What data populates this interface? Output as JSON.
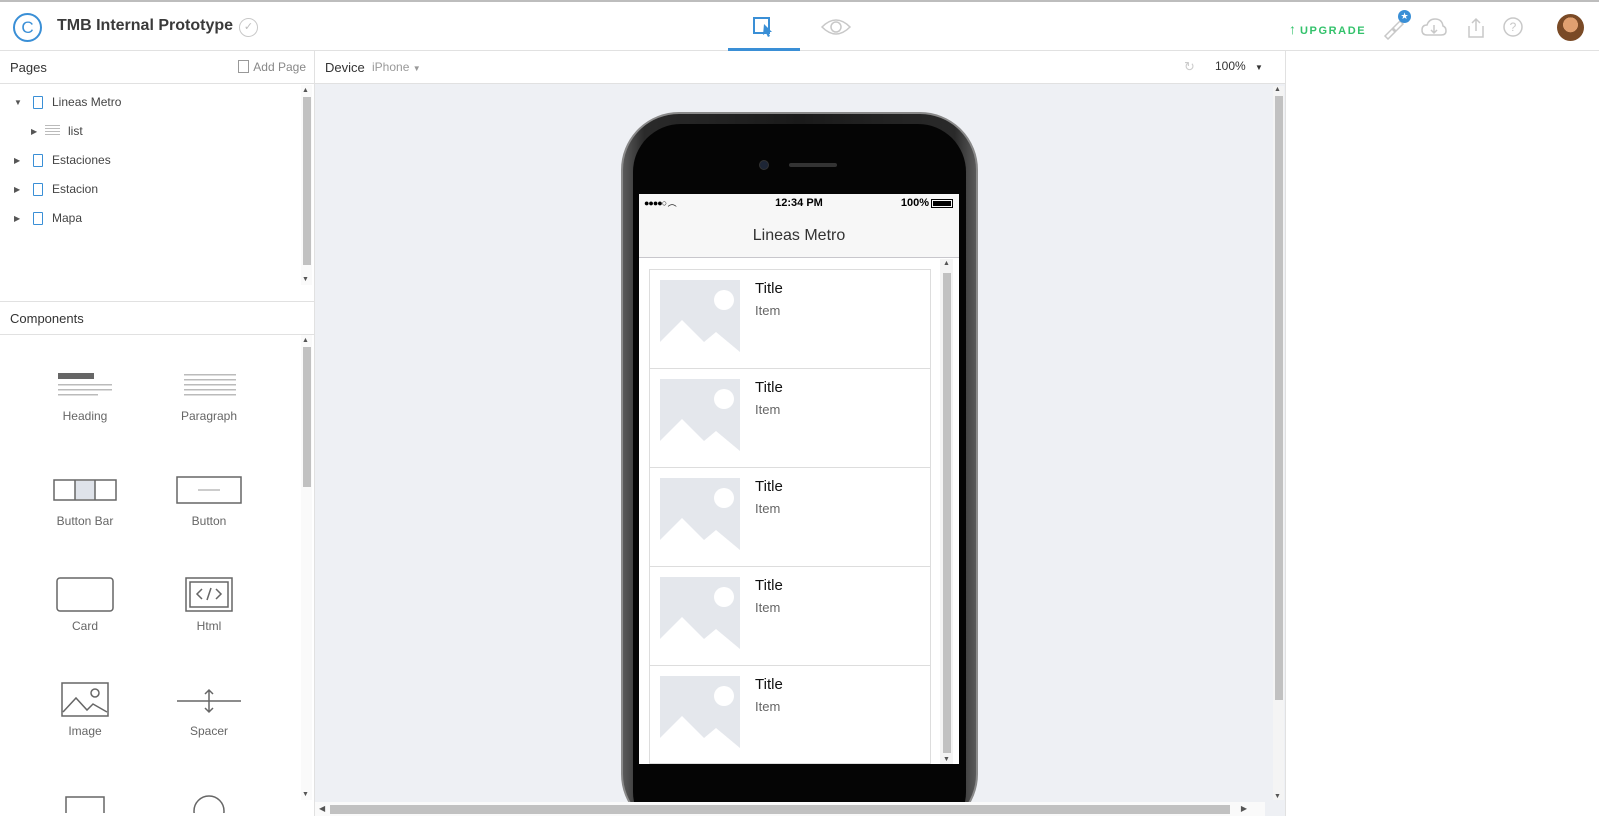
{
  "header": {
    "logo_glyph": "C",
    "app_title": "TMB Internal Prototype",
    "upgrade_label": "UPGRADE",
    "accent_color": "#3a8fd6",
    "upgrade_color": "#33c26b"
  },
  "pages_panel": {
    "title": "Pages",
    "add_page_label": "Add Page",
    "tree": [
      {
        "label": "Lineas Metro",
        "expanded": true
      },
      {
        "label": "list",
        "child": true
      },
      {
        "label": "Estaciones"
      },
      {
        "label": "Estacion"
      },
      {
        "label": "Mapa"
      }
    ]
  },
  "components_panel": {
    "title": "Components",
    "items": [
      {
        "label": "Heading",
        "icon": "heading-icon"
      },
      {
        "label": "Paragraph",
        "icon": "paragraph-icon"
      },
      {
        "label": "Button Bar",
        "icon": "button-bar-icon"
      },
      {
        "label": "Button",
        "icon": "button-icon"
      },
      {
        "label": "Card",
        "icon": "card-icon"
      },
      {
        "label": "Html",
        "icon": "html-icon"
      },
      {
        "label": "Image",
        "icon": "image-icon"
      },
      {
        "label": "Spacer",
        "icon": "spacer-icon"
      }
    ]
  },
  "toolbar": {
    "device_label": "Device",
    "device_value": "iPhone",
    "zoom": "100%"
  },
  "phone": {
    "status_time": "12:34 PM",
    "status_battery": "100%",
    "nav_title": "Lineas Metro",
    "list_items": [
      {
        "title": "Title",
        "subtitle": "Item"
      },
      {
        "title": "Title",
        "subtitle": "Item"
      },
      {
        "title": "Title",
        "subtitle": "Item"
      },
      {
        "title": "Title",
        "subtitle": "Item"
      },
      {
        "title": "Title",
        "subtitle": "Item"
      }
    ]
  }
}
